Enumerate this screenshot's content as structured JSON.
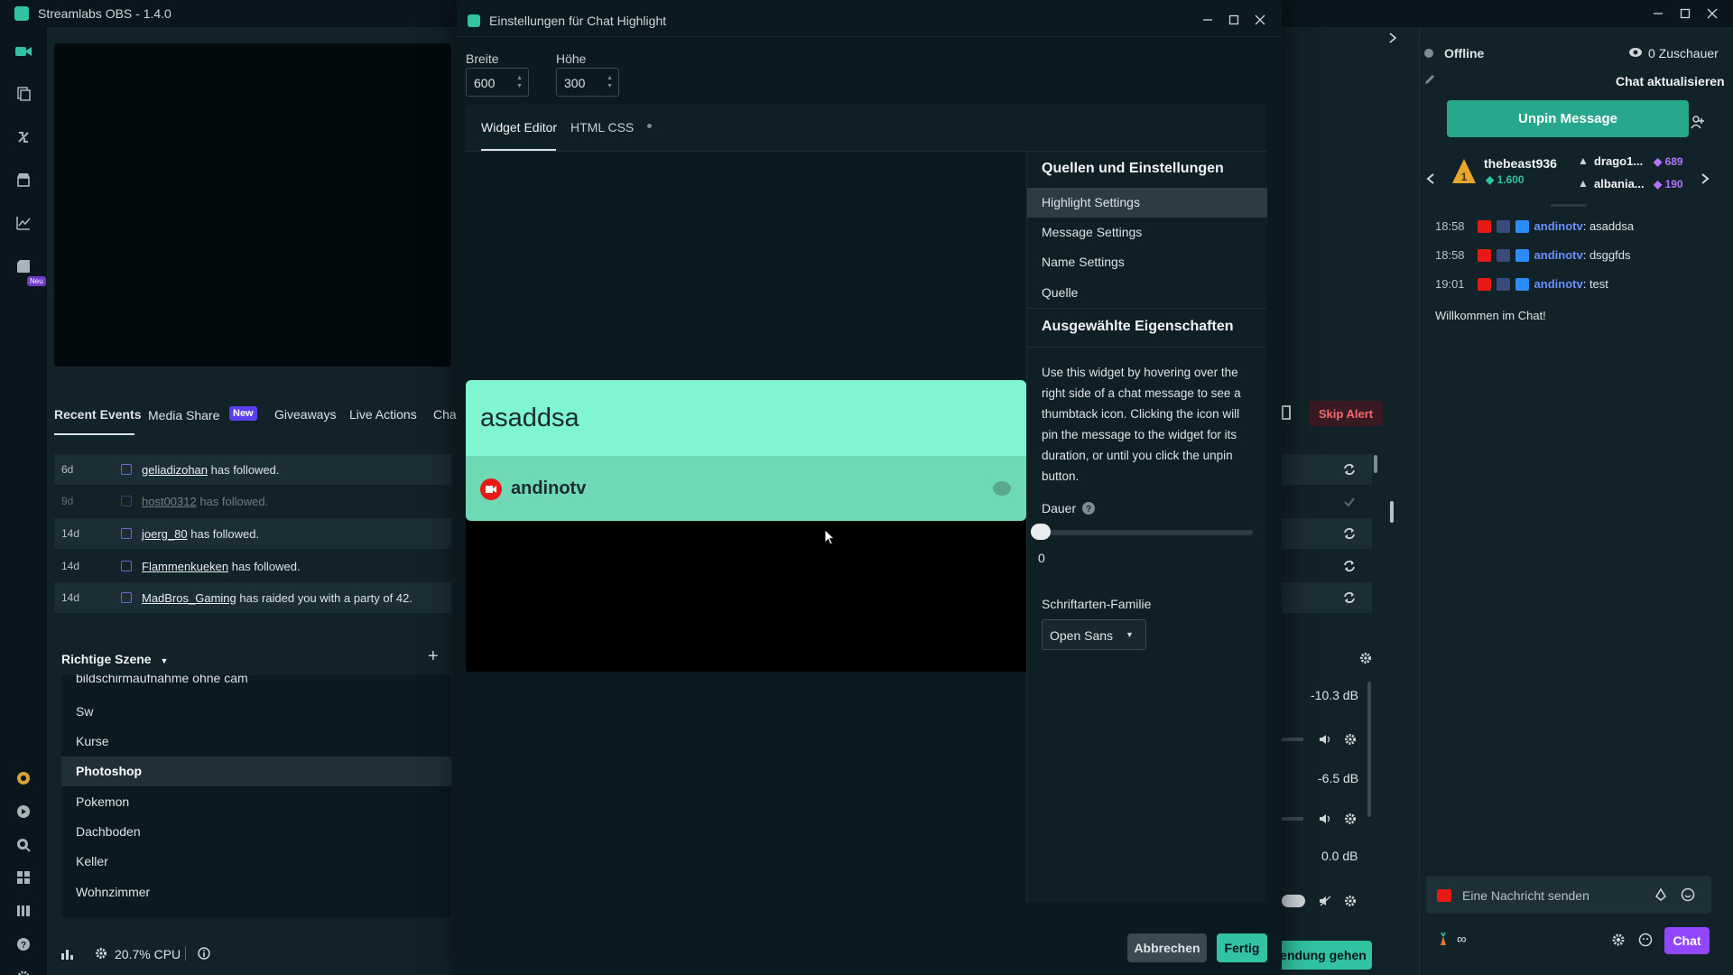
{
  "app": {
    "title": "Streamlabs OBS - 1.4.0"
  },
  "events": {
    "tabs": [
      "Recent Events",
      "Media Share",
      "Giveaways",
      "Live Actions",
      "Cha"
    ],
    "new_badge": "New",
    "skip_alert": "Skip Alert",
    "rows": [
      {
        "age": "6d",
        "user": "geliadizohan",
        "text": "has followed."
      },
      {
        "age": "9d",
        "user": "host00312",
        "text": "has followed."
      },
      {
        "age": "14d",
        "user": "joerg_80",
        "text": "has followed."
      },
      {
        "age": "14d",
        "user": "Flammenkueken",
        "text": "has followed."
      },
      {
        "age": "14d",
        "user": "MadBros_Gaming",
        "text": "has raided you with a party of 42."
      }
    ]
  },
  "scenes": {
    "title": "Richtige Szene",
    "items": [
      "bildschirmaufnahme ohne cam",
      "Sw",
      "Kurse",
      "Photoshop",
      "Pokemon",
      "Dachboden",
      "Keller",
      "Wohnzimmer"
    ],
    "selected_index": 3
  },
  "mixer": {
    "levels": [
      "-10.3 dB",
      "-6.5 dB",
      "0.0 dB"
    ]
  },
  "status": {
    "cpu": "20.7% CPU"
  },
  "go_live": "endung gehen",
  "rail": {
    "new_badge": "Neu"
  },
  "modal": {
    "title": "Einstellungen für Chat Highlight",
    "width_label": "Breite",
    "width_value": "600",
    "height_label": "Höhe",
    "height_value": "300",
    "tabs": [
      "Widget Editor",
      "HTML CSS"
    ],
    "active_tab": "Widget Editor",
    "preview": {
      "message": "asaddsa",
      "username": "andinotv"
    },
    "sections_header": "Quellen und Einstellungen",
    "menu": [
      "Highlight Settings",
      "Message Settings",
      "Name Settings",
      "Quelle"
    ],
    "menu_selected": "Highlight Settings",
    "props_header": "Ausgewählte Eigenschaften",
    "description": "Use this widget by hovering over the right side of a chat message to see a thumbtack icon. Clicking the icon will pin the message to the widget for its duration, or until you click the unpin button.",
    "duration_label": "Dauer",
    "duration_value": "0",
    "duration_level": 0,
    "font_label": "Schriftarten-Familie",
    "font_value": "Open Sans",
    "cancel": "Abbrechen",
    "done": "Fertig"
  },
  "chat": {
    "status": "Offline",
    "viewers": "0 Zuschauer",
    "refresh": "Chat aktualisieren",
    "unpin": "Unpin Message",
    "top": {
      "name": "thebeast936",
      "score": "1.600"
    },
    "others": [
      {
        "name": "drago1...",
        "score": "689"
      },
      {
        "name": "albania...",
        "score": "190"
      }
    ],
    "messages": [
      {
        "time": "18:58",
        "user": "andinotv",
        "text": ": asaddsa"
      },
      {
        "time": "18:58",
        "user": "andinotv",
        "text": ": dsggfds"
      },
      {
        "time": "19:01",
        "user": "andinotv",
        "text": ": test"
      }
    ],
    "welcome": "Willkommen im Chat!",
    "input_placeholder": "Eine Nachricht senden",
    "infinity": "∞",
    "chat_button": "Chat"
  },
  "colors": {
    "accent": "#31c3a2",
    "highlight_msg": "#80f5d2",
    "highlight_name": "#6fd8b4",
    "purple": "#9147ff"
  }
}
